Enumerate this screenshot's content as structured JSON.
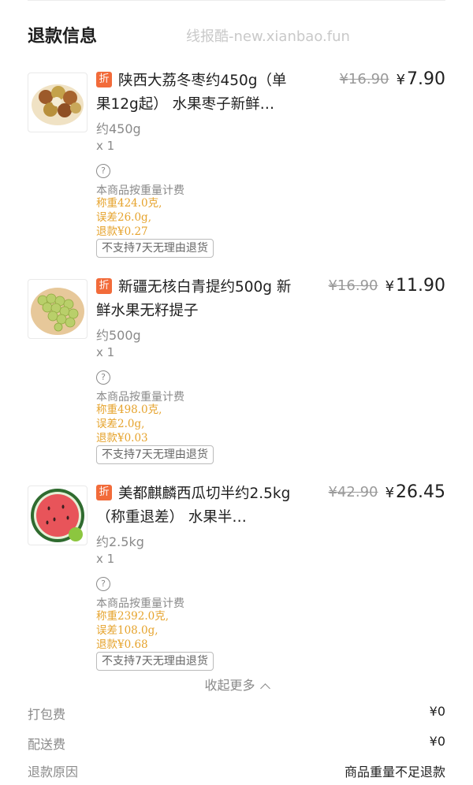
{
  "header": {
    "title": "退款信息",
    "watermark": "线报酷-new.xianbao.fun"
  },
  "items": [
    {
      "badge": "折",
      "name": "陕西大荔冬枣约450g（单果12g起） 水果枣子新鲜…",
      "orig_price": "¥16.90",
      "price_symbol": "¥",
      "price": "7.90",
      "spec": "约450g",
      "qty": "x 1",
      "help_icon": "?",
      "note": "本商品按重量计费",
      "weighed": "称重424.0克,",
      "error": "误差26.0g,",
      "refund": "退款¥0.27",
      "tag": "不支持7天无理由退货",
      "image": "jujube-image"
    },
    {
      "badge": "折",
      "name": "新疆无核白青提约500g 新鲜水果无籽提子",
      "orig_price": "¥16.90",
      "price_symbol": "¥",
      "price": "11.90",
      "spec": "约500g",
      "qty": "x 1",
      "help_icon": "?",
      "note": "本商品按重量计费",
      "weighed": "称重498.0克,",
      "error": "误差2.0g,",
      "refund": "退款¥0.03",
      "tag": "不支持7天无理由退货",
      "image": "grape-image"
    },
    {
      "badge": "折",
      "name": "美都麒麟西瓜切半约2.5kg（称重退差） 水果半…",
      "orig_price": "¥42.90",
      "price_symbol": "¥",
      "price": "26.45",
      "spec": "约2.5kg",
      "qty": "x 1",
      "help_icon": "?",
      "note": "本商品按重量计费",
      "weighed": "称重2392.0克,",
      "error": "误差108.0g,",
      "refund": "退款¥0.68",
      "tag": "不支持7天无理由退货",
      "image": "watermelon-image"
    }
  ],
  "collapse_label": "收起更多",
  "fees": [
    {
      "label": "打包费",
      "value": "¥0"
    },
    {
      "label": "配送费",
      "value": "¥0"
    },
    {
      "label": "退款原因",
      "value": "商品重量不足退款"
    }
  ],
  "colors": {
    "accent_orange": "#f26b3a",
    "weight_text": "#e6a32c"
  }
}
